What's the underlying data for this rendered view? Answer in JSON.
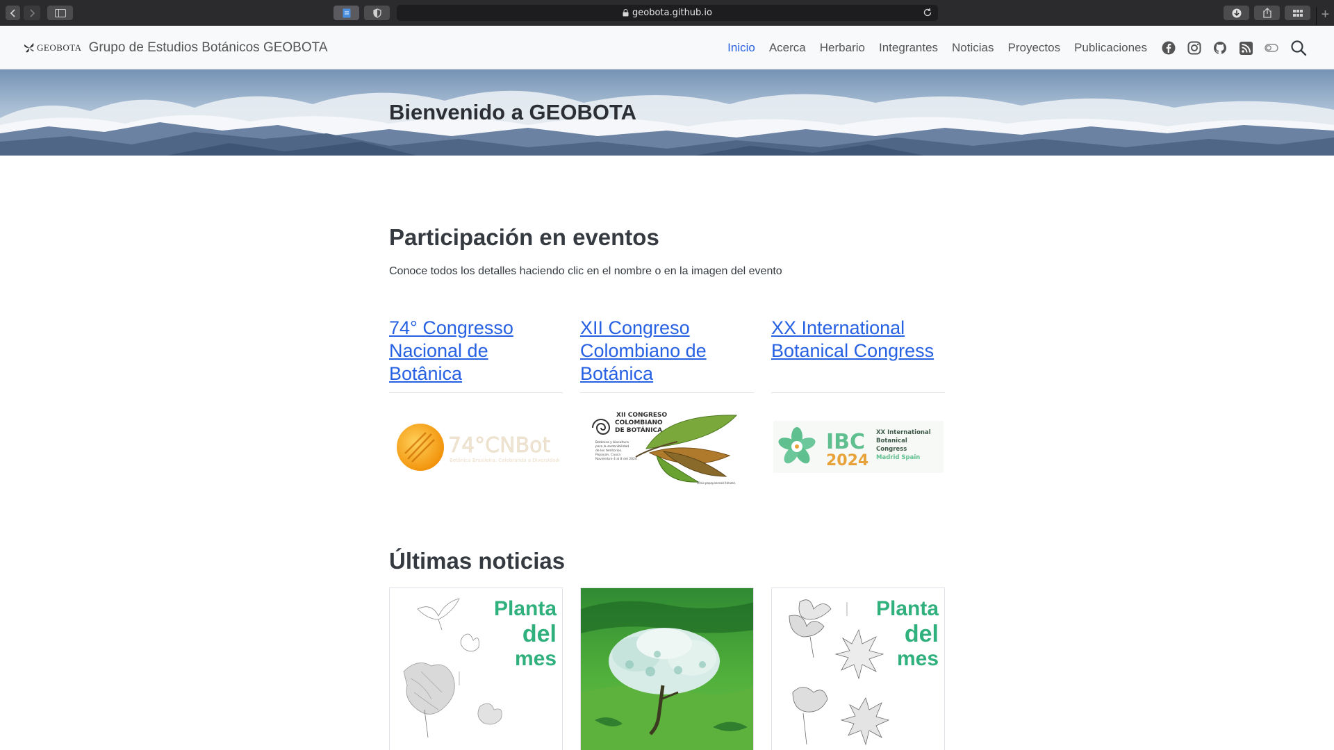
{
  "browser": {
    "url": "geobota.github.io"
  },
  "navbar": {
    "brand_logo_text": "GEOBOTA",
    "brand_title": "Grupo de Estudios Botánicos GEOBOTA",
    "links": [
      {
        "label": "Inicio",
        "active": true
      },
      {
        "label": "Acerca"
      },
      {
        "label": "Herbario"
      },
      {
        "label": "Integrantes"
      },
      {
        "label": "Noticias"
      },
      {
        "label": "Proyectos"
      },
      {
        "label": "Publicaciones"
      }
    ],
    "icons": [
      "facebook-icon",
      "instagram-icon",
      "github-icon",
      "rss-icon",
      "theme-toggle-icon",
      "search-icon"
    ]
  },
  "hero": {
    "title": "Bienvenido a GEOBOTA"
  },
  "events": {
    "title": "Participación en eventos",
    "description": "Conoce todos los detalles haciendo clic en el nombre o en la imagen del evento",
    "items": [
      {
        "name": "74° Congresso Nacional de Botânica",
        "image_text": "74°CNBot",
        "image_subtext": "Botânica Brasileira: Celebrando a Diversidade"
      },
      {
        "name": "XII Congreso Colombiano de Botánica",
        "image_text": "XII CONGRESO COLOMBIANO DE BOTÁNICA",
        "image_subtext": "Botánica y biocultura para la sostenibilidad de los territorios. Popayán, Cauca. Noviembre 4 al 8 del 2024"
      },
      {
        "name": "XX International Botanical Congress",
        "image_text": "IBC 2024",
        "image_subtext": "XX International Botanical Congress Madrid Spain"
      }
    ]
  },
  "news": {
    "title": "Últimas noticias",
    "cards": [
      {
        "kind": "planta-del-mes",
        "label_lines": [
          "Planta",
          "del",
          "mes"
        ]
      },
      {
        "kind": "photo"
      },
      {
        "kind": "planta-del-mes",
        "label_lines": [
          "Planta",
          "del",
          "mes"
        ]
      }
    ]
  },
  "colors": {
    "accent": "#2761e3",
    "planta_green": "#2fb07c",
    "navbar_bg": "#f8f9fa"
  }
}
